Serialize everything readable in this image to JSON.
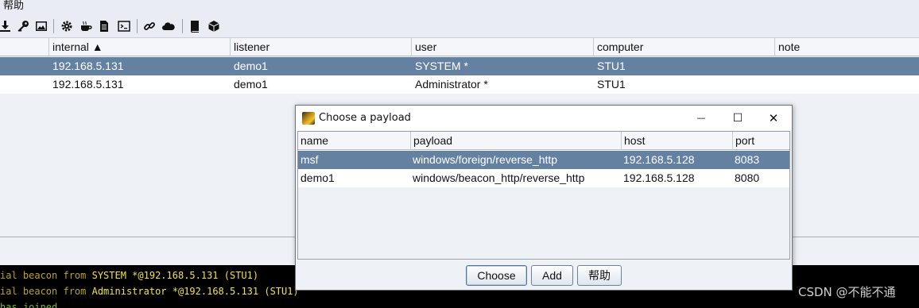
{
  "menu": {
    "help_label": "帮助"
  },
  "toolbar": {
    "icons": [
      "download-icon",
      "key-icon",
      "image-icon",
      "gear-icon",
      "coffee-icon",
      "document-icon",
      "terminal-icon",
      "link-icon",
      "cloud-icon",
      "book-icon",
      "package-icon"
    ]
  },
  "table": {
    "columns": [
      "internal ▲",
      "listener",
      "user",
      "computer",
      "note"
    ],
    "rows": [
      {
        "internal": "192.168.5.131",
        "listener": "demo1",
        "user": "SYSTEM *",
        "computer": "STU1",
        "note": ""
      },
      {
        "internal": "192.168.5.131",
        "listener": "demo1",
        "user": "Administrator *",
        "computer": "STU1",
        "note": ""
      }
    ]
  },
  "console": {
    "lines": [
      {
        "prefix": "ial beacon from ",
        "user": "SYSTEM *",
        "rest": "@192.168.5.131 (STU1)"
      },
      {
        "prefix": "ial beacon from ",
        "user": "Administrator *",
        "rest": "@192.168.5.131 (STU1)"
      },
      {
        "text": "has joined"
      }
    ]
  },
  "dialog": {
    "title": "Choose a payload",
    "controls": {
      "minimize": "—",
      "maximize": "☐",
      "close": "✕"
    },
    "columns": [
      "name",
      "payload",
      "host",
      "port"
    ],
    "rows": [
      {
        "name": "msf",
        "payload": "windows/foreign/reverse_http",
        "host": "192.168.5.128",
        "port": "8083"
      },
      {
        "name": "demo1",
        "payload": "windows/beacon_http/reverse_http",
        "host": "192.168.5.128",
        "port": "8080"
      }
    ],
    "buttons": {
      "choose": "Choose",
      "add": "Add",
      "help": "帮助"
    }
  },
  "watermark": "CSDN @不能不通",
  "colors": {
    "selection": "#6481a1",
    "console_bg": "#000000",
    "console_user": "#f2e14a",
    "console_text": "#b7a12c"
  }
}
